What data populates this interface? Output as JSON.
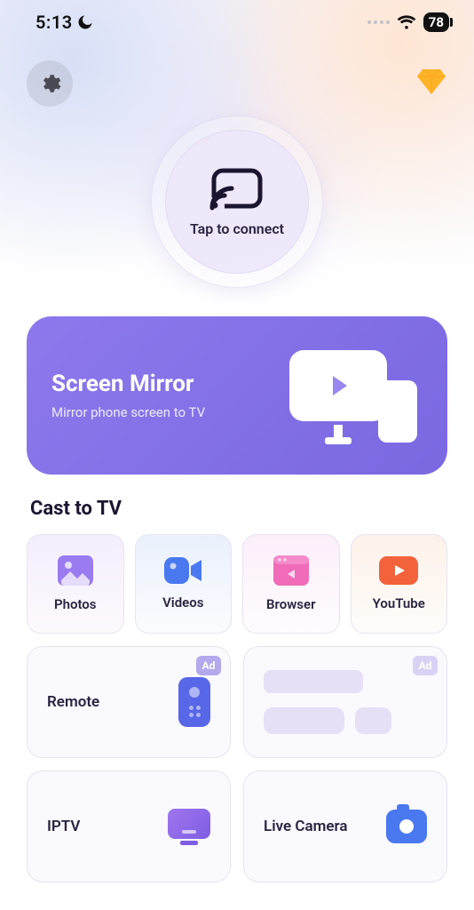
{
  "status": {
    "time": "5:13",
    "battery": "78"
  },
  "connect": {
    "label": "Tap to connect"
  },
  "mirror": {
    "title": "Screen Mirror",
    "subtitle": "Mirror phone screen to TV"
  },
  "section_cast_title": "Cast to TV",
  "tiles": {
    "photos": "Photos",
    "videos": "Videos",
    "browser": "Browser",
    "youtube": "YouTube"
  },
  "wide": {
    "remote": "Remote",
    "iptv": "IPTV",
    "live_camera": "Live Camera",
    "ad_label": "Ad"
  }
}
